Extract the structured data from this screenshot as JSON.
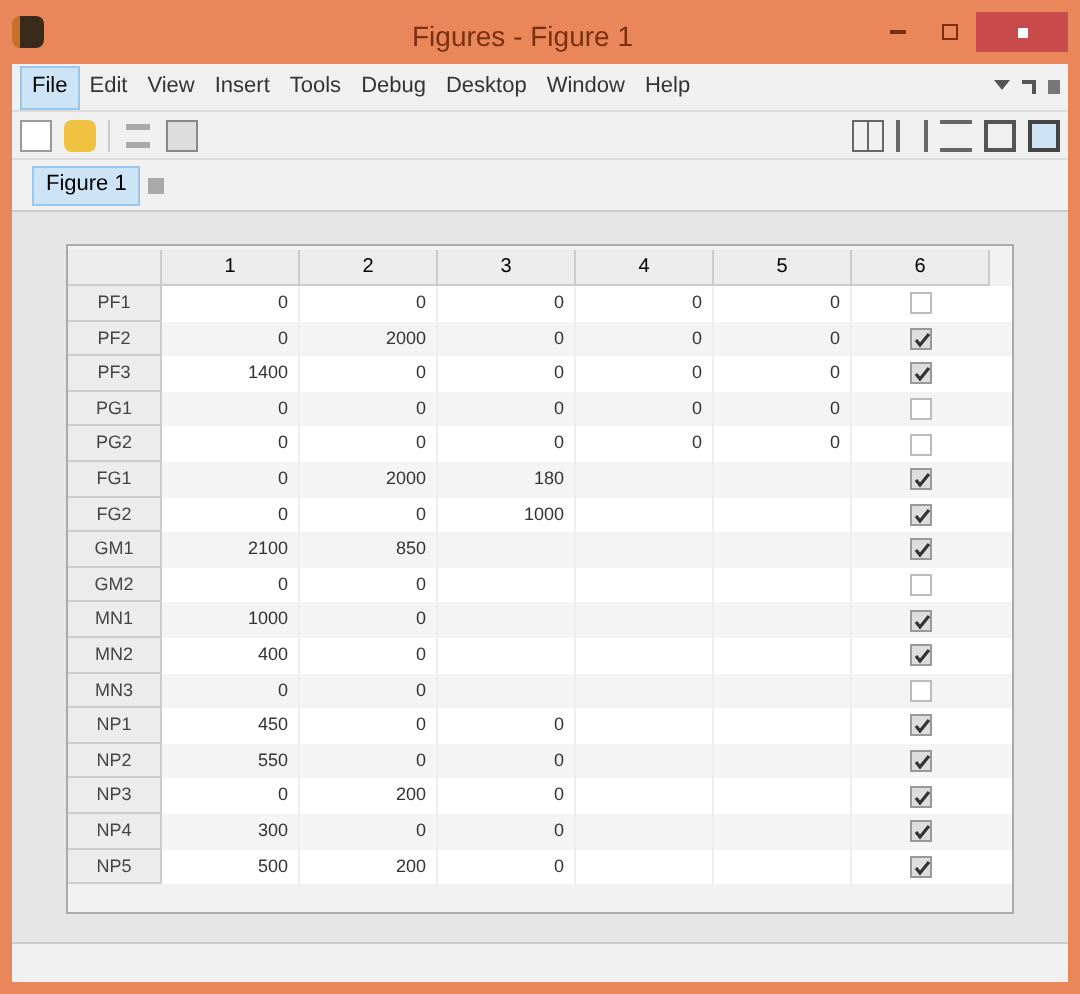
{
  "window": {
    "title": "Figures - Figure 1"
  },
  "menu": [
    {
      "label": "File",
      "selected": true
    },
    {
      "label": "Edit",
      "selected": false
    },
    {
      "label": "View",
      "selected": false
    },
    {
      "label": "Insert",
      "selected": false
    },
    {
      "label": "Tools",
      "selected": false
    },
    {
      "label": "Debug",
      "selected": false
    },
    {
      "label": "Desktop",
      "selected": false
    },
    {
      "label": "Window",
      "selected": false
    },
    {
      "label": "Help",
      "selected": false
    }
  ],
  "tabs": [
    {
      "label": "Figure 1",
      "selected": true
    }
  ],
  "table": {
    "columns": [
      "1",
      "2",
      "3",
      "4",
      "5",
      "6"
    ],
    "rows": [
      {
        "label": "PF1",
        "cells": [
          "0",
          "0",
          "0",
          "0",
          "0"
        ],
        "checked": false
      },
      {
        "label": "PF2",
        "cells": [
          "0",
          "2000",
          "0",
          "0",
          "0"
        ],
        "checked": true
      },
      {
        "label": "PF3",
        "cells": [
          "1400",
          "0",
          "0",
          "0",
          "0"
        ],
        "checked": true
      },
      {
        "label": "PG1",
        "cells": [
          "0",
          "0",
          "0",
          "0",
          "0"
        ],
        "checked": false
      },
      {
        "label": "PG2",
        "cells": [
          "0",
          "0",
          "0",
          "0",
          "0"
        ],
        "checked": false
      },
      {
        "label": "FG1",
        "cells": [
          "0",
          "2000",
          "180"
        ],
        "checked": true
      },
      {
        "label": "FG2",
        "cells": [
          "0",
          "0",
          "1000"
        ],
        "checked": true
      },
      {
        "label": "GM1",
        "cells": [
          "2100",
          "850"
        ],
        "checked": true
      },
      {
        "label": "GM2",
        "cells": [
          "0",
          "0"
        ],
        "checked": false
      },
      {
        "label": "MN1",
        "cells": [
          "1000",
          "0"
        ],
        "checked": true
      },
      {
        "label": "MN2",
        "cells": [
          "400",
          "0"
        ],
        "checked": true
      },
      {
        "label": "MN3",
        "cells": [
          "0",
          "0"
        ],
        "checked": false
      },
      {
        "label": "NP1",
        "cells": [
          "450",
          "0",
          "0"
        ],
        "checked": true
      },
      {
        "label": "NP2",
        "cells": [
          "550",
          "0",
          "0"
        ],
        "checked": true
      },
      {
        "label": "NP3",
        "cells": [
          "0",
          "200",
          "0"
        ],
        "checked": true
      },
      {
        "label": "NP4",
        "cells": [
          "300",
          "0",
          "0"
        ],
        "checked": true
      },
      {
        "label": "NP5",
        "cells": [
          "500",
          "200",
          "0"
        ],
        "checked": true
      }
    ]
  }
}
